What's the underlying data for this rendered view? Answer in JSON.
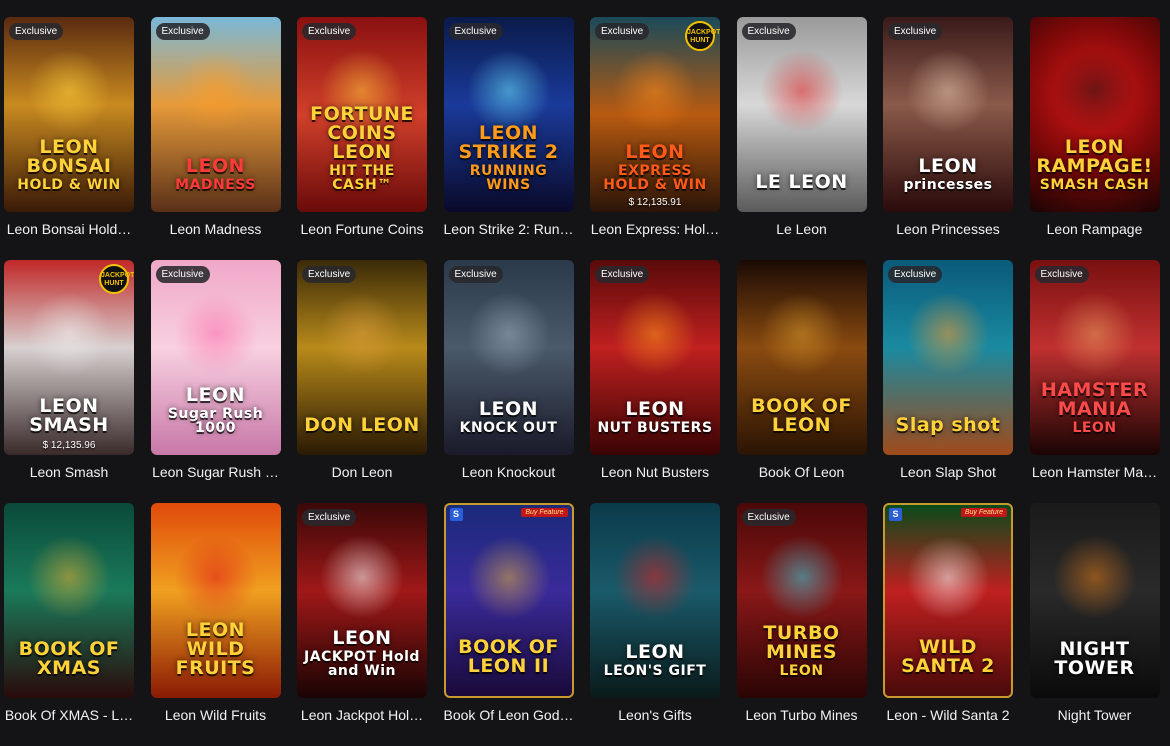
{
  "games": [
    {
      "title": "Leon Bonsai Hold…",
      "badge": "Exclusive",
      "logo": "LEON BONSAI",
      "logo2": "HOLD & WIN",
      "bg": "linear-gradient(180deg,#5a2a10 0%,#c98a20 45%,#3a1a08 100%)",
      "accent": "#ffd23a",
      "logo_color": "#ffd23a"
    },
    {
      "title": "Leon Madness",
      "badge": "Exclusive",
      "logo": "LEON",
      "logo2": "MADNESS",
      "bg": "linear-gradient(180deg,#7ab8d8 0%,#e69a3a 45%,#5a3018 100%)",
      "accent": "#ff9a20",
      "logo_color": "#ff3a3a"
    },
    {
      "title": "Leon Fortune Coins",
      "badge": "Exclusive",
      "logo": "FORTUNE COINS LEON",
      "logo2": "HIT THE CASH™",
      "bg": "linear-gradient(180deg,#8a1010 0%,#d0402a 50%,#6a0a0a 100%)",
      "accent": "#ffc63a",
      "logo_color": "#ffd23a"
    },
    {
      "title": "Leon Strike 2: Run…",
      "badge": "Exclusive",
      "logo": "LEON STRIKE 2",
      "logo2": "RUNNING WINS",
      "bg": "linear-gradient(180deg,#0a1a4a 0%,#1a3a9a 45%,#0a0a2a 100%)",
      "accent": "#6ae8ff",
      "logo_color": "#ff9a1a"
    },
    {
      "title": "Leon Express: Hol…",
      "badge": "Exclusive",
      "logo": "LEON",
      "logo2": "EXPRESS HOLD & WIN",
      "bg": "linear-gradient(180deg,#1a4a5a 0%,#b85a10 50%,#2a1408 100%)",
      "accent": "#ff8a1a",
      "logo_color": "#ff5a1a",
      "jackpot": "JACKPOT HUNT",
      "amount": "$ 12,135.91"
    },
    {
      "title": "Le Leon",
      "badge": "Exclusive",
      "logo": "LE LEON",
      "bg": "linear-gradient(180deg,#9a9a9a 0%,#d8d8d8 45%,#5a5a5a 100%)",
      "accent": "#e02020",
      "logo_color": "#ffffff"
    },
    {
      "title": "Leon Princesses",
      "badge": "Exclusive",
      "logo": "LEON",
      "logo2": "princesses",
      "bg": "linear-gradient(180deg,#3a1a1a 0%,#8a5a4a 45%,#2a0a0a 100%)",
      "accent": "#e8c8b0",
      "logo_color": "#ffffff"
    },
    {
      "title": "Leon Rampage",
      "logo": "LEON RAMPAGE!",
      "logo2": "SMASH CASH",
      "bg": "radial-gradient(circle at 50% 40%,#e01818 0%,#7a0808 55%,#1a0404 100%)",
      "accent": "#111111",
      "logo_color": "#ffd23a"
    },
    {
      "title": "Leon Smash",
      "logo": "LEON SMASH",
      "bg": "linear-gradient(180deg,#c02828 0%,#d8d0d0 45%,#3a2a2a 100%)",
      "accent": "#f0f0f0",
      "logo_color": "#ffffff",
      "jackpot": "JACKPOT HUNT",
      "amount": "$ 12,135.96"
    },
    {
      "title": "Leon Sugar Rush …",
      "badge": "Exclusive",
      "logo": "LEON",
      "logo2": "Sugar Rush 1000",
      "bg": "linear-gradient(180deg,#f0a8c8 0%,#f8d0e0 45%,#c878a8 100%)",
      "accent": "#ff6aa8",
      "logo_color": "#ffffff"
    },
    {
      "title": "Don Leon",
      "badge": "Exclusive",
      "logo": "DON LEON",
      "bg": "linear-gradient(180deg,#3a2a08 0%,#b88a1a 45%,#2a1a04 100%)",
      "accent": "#e0a040",
      "logo_color": "#ffd23a"
    },
    {
      "title": "Leon Knockout",
      "badge": "Exclusive",
      "logo": "LEON",
      "logo2": "KNOCK OUT",
      "bg": "linear-gradient(180deg,#2a3a4a 0%,#4a5a6a 45%,#1a1a2a 100%)",
      "accent": "#a0b0c0",
      "logo_color": "#ffffff"
    },
    {
      "title": "Leon Nut Busters",
      "badge": "Exclusive",
      "logo": "LEON",
      "logo2": "NUT BUSTERS",
      "bg": "linear-gradient(180deg,#5a0a0a 0%,#c02020 45%,#3a0404 100%)",
      "accent": "#ff9a1a",
      "logo_color": "#ffffff"
    },
    {
      "title": "Book Of Leon",
      "logo": "BOOK OF LEON",
      "bg": "linear-gradient(180deg,#1a0a04 0%,#8a4a10 45%,#2a1404 100%)",
      "accent": "#d89a2a",
      "logo_color": "#ffd23a"
    },
    {
      "title": "Leon Slap Shot",
      "badge": "Exclusive",
      "logo": "Slap shot",
      "bg": "linear-gradient(180deg,#0a5a7a 0%,#1a8aa0 45%,#a04a1a 100%)",
      "accent": "#ff9a2a",
      "logo_color": "#ffd23a"
    },
    {
      "title": "Leon Hamster Ma…",
      "badge": "Exclusive",
      "logo": "HAMSTER MANIA",
      "logo2": "LEON",
      "bg": "linear-gradient(180deg,#7a1010 0%,#c03030 45%,#1a0404 100%)",
      "accent": "#e8a060",
      "logo_color": "#ff4a4a"
    },
    {
      "title": "Book Of XMAS - L…",
      "logo": "BOOK OF XMAS",
      "bg": "linear-gradient(180deg,#0a4a3a 0%,#1a7a5a 45%,#2a0a0a 100%)",
      "accent": "#e8b030",
      "logo_color": "#ffd23a"
    },
    {
      "title": "Leon Wild Fruits",
      "logo": "LEON WILD FRUITS",
      "bg": "linear-gradient(180deg,#e04a0a 0%,#f0a020 45%,#8a1a04 100%)",
      "accent": "#e01818",
      "logo_color": "#ffd23a"
    },
    {
      "title": "Leon Jackpot Hol…",
      "badge": "Exclusive",
      "logo": "LEON",
      "logo2": "JACKPOT Hold and Win",
      "bg": "linear-gradient(180deg,#3a0808 0%,#a01818 45%,#1a0404 100%)",
      "accent": "#ffffff",
      "logo_color": "#ffffff"
    },
    {
      "title": "Book Of Leon God…",
      "logo": "BOOK OF LEON II",
      "bg": "linear-gradient(180deg,#1a2a7a 0%,#3a2a9a 45%,#1a0a3a 100%)",
      "accent": "#e0b040",
      "logo_color": "#ffd23a",
      "buy": "Buy Feature",
      "s": "S",
      "framed": true
    },
    {
      "title": "Leon's Gifts",
      "logo": "LEON",
      "logo2": "LEON'S GIFT",
      "bg": "linear-gradient(180deg,#0a3a4a 0%,#1a5a6a 45%,#0a1a1a 100%)",
      "accent": "#e02020",
      "logo_color": "#ffffff"
    },
    {
      "title": "Leon Turbo Mines",
      "badge": "Exclusive",
      "logo": "TURBO MINES",
      "logo2": "LEON",
      "bg": "linear-gradient(180deg,#4a0808 0%,#8a1818 45%,#2a0404 100%)",
      "accent": "#3ad0e0",
      "logo_color": "#ffd23a"
    },
    {
      "title": "Leon - Wild Santa 2",
      "logo": "WILD SANTA 2",
      "bg": "linear-gradient(180deg,#0a4a1a 0%,#c02020 45%,#4a0a0a 100%)",
      "accent": "#ffffff",
      "logo_color": "#ffd23a",
      "buy": "Buy Feature",
      "s": "S",
      "framed": true
    },
    {
      "title": "Night Tower",
      "logo": "NIGHT TOWER",
      "bg": "linear-gradient(180deg,#1a1a1a 0%,#2a2a2a 45%,#0a0a0a 100%)",
      "accent": "#e07a1a",
      "logo_color": "#ffffff"
    }
  ]
}
